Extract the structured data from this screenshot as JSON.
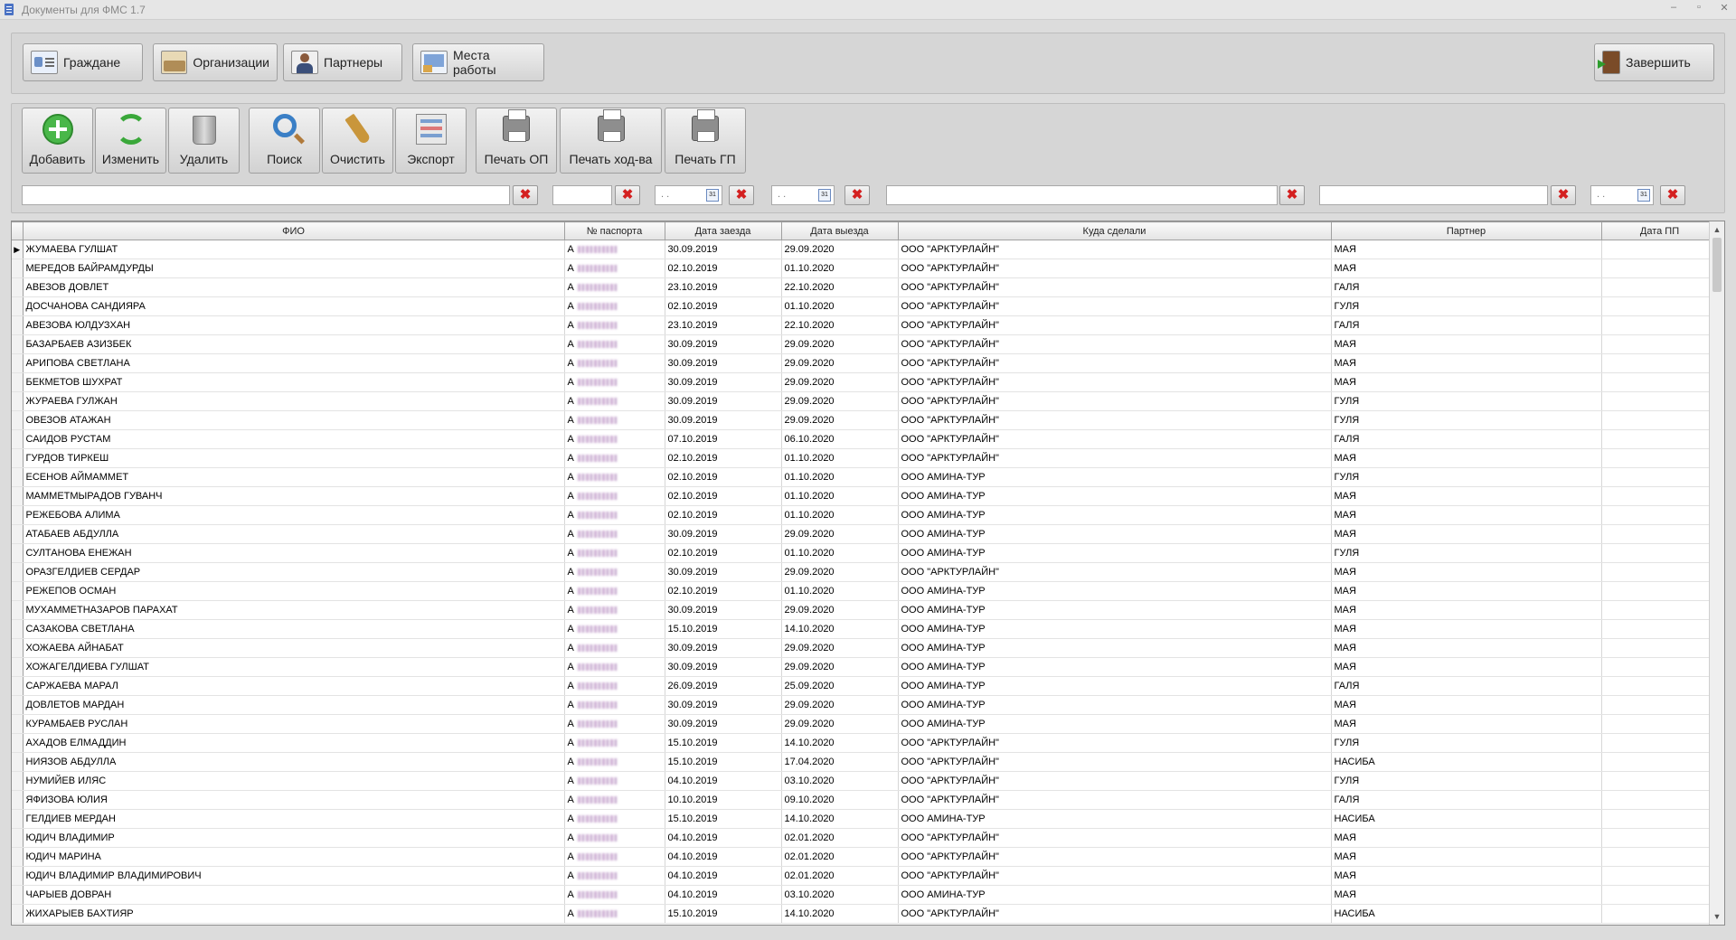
{
  "window": {
    "title": "Документы для ФМС 1.7",
    "controls": [
      "–",
      "▫",
      "✕"
    ]
  },
  "nav": {
    "citizens": "Граждане",
    "organizations": "Организации",
    "partners": "Партнеры",
    "workplaces": "Места работы",
    "finish": "Завершить"
  },
  "toolbar": {
    "add": "Добавить",
    "edit": "Изменить",
    "delete": "Удалить",
    "search": "Поиск",
    "clear": "Очистить",
    "export": "Экспорт",
    "print_op": "Печать ОП",
    "print_hod": "Печать ход-ва",
    "print_gp": "Печать ГП"
  },
  "filters": {
    "date_placeholder": ". .",
    "calendar_label": "31",
    "clear_symbol": "✖"
  },
  "grid": {
    "columns": [
      "ФИО",
      "№ паспорта",
      "Дата заезда",
      "Дата выезда",
      "Куда сделали",
      "Партнер",
      "Дата ПП"
    ],
    "current_row_marker": "▶",
    "scroll_up": "▲",
    "scroll_down": "▼",
    "rows": [
      {
        "fio": "ЖУМАЕВА ГУЛШАТ",
        "passport": "А",
        "in": "30.09.2019",
        "out": "29.09.2020",
        "where": "ООО \"АРКТУРЛАЙН\"",
        "partner": "МАЯ",
        "pp": ""
      },
      {
        "fio": "МЕРЕДОВ БАЙРАМДУРДЫ",
        "passport": "А",
        "in": "02.10.2019",
        "out": "01.10.2020",
        "where": "ООО \"АРКТУРЛАЙН\"",
        "partner": "МАЯ",
        "pp": ""
      },
      {
        "fio": "АВЕЗОВ ДОВЛЕТ",
        "passport": "А",
        "in": "23.10.2019",
        "out": "22.10.2020",
        "where": "ООО \"АРКТУРЛАЙН\"",
        "partner": "ГАЛЯ",
        "pp": ""
      },
      {
        "fio": "ДОСЧАНОВА САНДИЯРА",
        "passport": "А",
        "in": "02.10.2019",
        "out": "01.10.2020",
        "where": "ООО \"АРКТУРЛАЙН\"",
        "partner": "ГУЛЯ",
        "pp": ""
      },
      {
        "fio": "АВЕЗОВА ЮЛДУЗХАН",
        "passport": "А",
        "in": "23.10.2019",
        "out": "22.10.2020",
        "where": "ООО \"АРКТУРЛАЙН\"",
        "partner": "ГАЛЯ",
        "pp": ""
      },
      {
        "fio": "БАЗАРБАЕВ АЗИЗБЕК",
        "passport": "А",
        "in": "30.09.2019",
        "out": "29.09.2020",
        "where": "ООО \"АРКТУРЛАЙН\"",
        "partner": "МАЯ",
        "pp": ""
      },
      {
        "fio": "АРИПОВА СВЕТЛАНА",
        "passport": "А",
        "in": "30.09.2019",
        "out": "29.09.2020",
        "where": "ООО \"АРКТУРЛАЙН\"",
        "partner": "МАЯ",
        "pp": ""
      },
      {
        "fio": "БЕКМЕТОВ ШУХРАТ",
        "passport": "А",
        "in": "30.09.2019",
        "out": "29.09.2020",
        "where": "ООО \"АРКТУРЛАЙН\"",
        "partner": "МАЯ",
        "pp": ""
      },
      {
        "fio": "ЖУРАЕВА ГУЛЖАН",
        "passport": "А",
        "in": "30.09.2019",
        "out": "29.09.2020",
        "where": "ООО \"АРКТУРЛАЙН\"",
        "partner": "ГУЛЯ",
        "pp": ""
      },
      {
        "fio": "ОВЕЗОВ АТАЖАН",
        "passport": "А",
        "in": "30.09.2019",
        "out": "29.09.2020",
        "where": "ООО \"АРКТУРЛАЙН\"",
        "partner": "ГУЛЯ",
        "pp": ""
      },
      {
        "fio": "САИДОВ РУСТАМ",
        "passport": "А",
        "in": "07.10.2019",
        "out": "06.10.2020",
        "where": "ООО \"АРКТУРЛАЙН\"",
        "partner": "ГАЛЯ",
        "pp": ""
      },
      {
        "fio": "ГУРДОВ ТИРКЕШ",
        "passport": "А",
        "in": "02.10.2019",
        "out": "01.10.2020",
        "where": "ООО \"АРКТУРЛАЙН\"",
        "partner": "МАЯ",
        "pp": ""
      },
      {
        "fio": "ЕСЕНОВ АЙМАММЕТ",
        "passport": "А",
        "in": "02.10.2019",
        "out": "01.10.2020",
        "where": "ООО АМИНА-ТУР",
        "partner": "ГУЛЯ",
        "pp": ""
      },
      {
        "fio": "МАММЕТМЫРАДОВ ГУВАНЧ",
        "passport": "А",
        "in": "02.10.2019",
        "out": "01.10.2020",
        "where": "ООО АМИНА-ТУР",
        "partner": "МАЯ",
        "pp": ""
      },
      {
        "fio": "РЕЖЕБОВА АЛИМА",
        "passport": "А",
        "in": "02.10.2019",
        "out": "01.10.2020",
        "where": "ООО АМИНА-ТУР",
        "partner": "МАЯ",
        "pp": ""
      },
      {
        "fio": "АТАБАЕВ АБДУЛЛА",
        "passport": "А",
        "in": "30.09.2019",
        "out": "29.09.2020",
        "where": "ООО АМИНА-ТУР",
        "partner": "МАЯ",
        "pp": ""
      },
      {
        "fio": "СУЛТАНОВА ЕНЕЖАН",
        "passport": "А",
        "in": "02.10.2019",
        "out": "01.10.2020",
        "where": "ООО АМИНА-ТУР",
        "partner": "ГУЛЯ",
        "pp": ""
      },
      {
        "fio": "ОРАЗГЕЛДИЕВ СЕРДАР",
        "passport": "А",
        "in": "30.09.2019",
        "out": "29.09.2020",
        "where": "ООО \"АРКТУРЛАЙН\"",
        "partner": "МАЯ",
        "pp": ""
      },
      {
        "fio": "РЕЖЕПОВ ОСМАН",
        "passport": "А",
        "in": "02.10.2019",
        "out": "01.10.2020",
        "where": "ООО АМИНА-ТУР",
        "partner": "МАЯ",
        "pp": ""
      },
      {
        "fio": "МУХАММЕТНАЗАРОВ ПАРАХАТ",
        "passport": "А",
        "in": "30.09.2019",
        "out": "29.09.2020",
        "where": "ООО АМИНА-ТУР",
        "partner": "МАЯ",
        "pp": ""
      },
      {
        "fio": "САЗАКОВА СВЕТЛАНА",
        "passport": "А",
        "in": "15.10.2019",
        "out": "14.10.2020",
        "where": "ООО АМИНА-ТУР",
        "partner": "МАЯ",
        "pp": ""
      },
      {
        "fio": "ХОЖАЕВА АЙНАБАТ",
        "passport": "А",
        "in": "30.09.2019",
        "out": "29.09.2020",
        "where": "ООО АМИНА-ТУР",
        "partner": "МАЯ",
        "pp": ""
      },
      {
        "fio": "ХОЖАГЕЛДИЕВА ГУЛШАТ",
        "passport": "А",
        "in": "30.09.2019",
        "out": "29.09.2020",
        "where": "ООО АМИНА-ТУР",
        "partner": "МАЯ",
        "pp": ""
      },
      {
        "fio": "САРЖАЕВА МАРАЛ",
        "passport": "А",
        "in": "26.09.2019",
        "out": "25.09.2020",
        "where": "ООО АМИНА-ТУР",
        "partner": "ГАЛЯ",
        "pp": ""
      },
      {
        "fio": "ДОВЛЕТОВ МАРДАН",
        "passport": "А",
        "in": "30.09.2019",
        "out": "29.09.2020",
        "where": "ООО АМИНА-ТУР",
        "partner": "МАЯ",
        "pp": ""
      },
      {
        "fio": "КУРАМБАЕВ РУСЛАН",
        "passport": "А",
        "in": "30.09.2019",
        "out": "29.09.2020",
        "where": "ООО АМИНА-ТУР",
        "partner": "МАЯ",
        "pp": ""
      },
      {
        "fio": "АХАДОВ ЕЛМАДДИН",
        "passport": "А",
        "in": "15.10.2019",
        "out": "14.10.2020",
        "where": "ООО \"АРКТУРЛАЙН\"",
        "partner": "ГУЛЯ",
        "pp": ""
      },
      {
        "fio": "НИЯЗОВ АБДУЛЛА",
        "passport": "А",
        "in": "15.10.2019",
        "out": "17.04.2020",
        "where": "ООО \"АРКТУРЛАЙН\"",
        "partner": "НАСИБА",
        "pp": ""
      },
      {
        "fio": "НУМИЙЕВ ИЛЯС",
        "passport": "А",
        "in": "04.10.2019",
        "out": "03.10.2020",
        "where": "ООО \"АРКТУРЛАЙН\"",
        "partner": "ГУЛЯ",
        "pp": ""
      },
      {
        "fio": "ЯФИЗОВА ЮЛИЯ",
        "passport": "А",
        "in": "10.10.2019",
        "out": "09.10.2020",
        "where": "ООО \"АРКТУРЛАЙН\"",
        "partner": "ГАЛЯ",
        "pp": ""
      },
      {
        "fio": "ГЕЛДИЕВ МЕРДАН",
        "passport": "А",
        "in": "15.10.2019",
        "out": "14.10.2020",
        "where": "ООО АМИНА-ТУР",
        "partner": "НАСИБА",
        "pp": ""
      },
      {
        "fio": "ЮДИЧ ВЛАДИМИР",
        "passport": "А",
        "in": "04.10.2019",
        "out": "02.01.2020",
        "where": "ООО \"АРКТУРЛАЙН\"",
        "partner": "МАЯ",
        "pp": ""
      },
      {
        "fio": "ЮДИЧ МАРИНА",
        "passport": "А",
        "in": "04.10.2019",
        "out": "02.01.2020",
        "where": "ООО \"АРКТУРЛАЙН\"",
        "partner": "МАЯ",
        "pp": ""
      },
      {
        "fio": "ЮДИЧ ВЛАДИМИР ВЛАДИМИРОВИЧ",
        "passport": "А",
        "in": "04.10.2019",
        "out": "02.01.2020",
        "where": "ООО \"АРКТУРЛАЙН\"",
        "partner": "МАЯ",
        "pp": ""
      },
      {
        "fio": "ЧАРЫЕВ ДОВРАН",
        "passport": "А",
        "in": "04.10.2019",
        "out": "03.10.2020",
        "where": "ООО АМИНА-ТУР",
        "partner": "МАЯ",
        "pp": ""
      },
      {
        "fio": "ЖИХАРЫЕВ БАХТИЯР",
        "passport": "А",
        "in": "15.10.2019",
        "out": "14.10.2020",
        "where": "ООО \"АРКТУРЛАЙН\"",
        "partner": "НАСИБА",
        "pp": ""
      }
    ]
  }
}
